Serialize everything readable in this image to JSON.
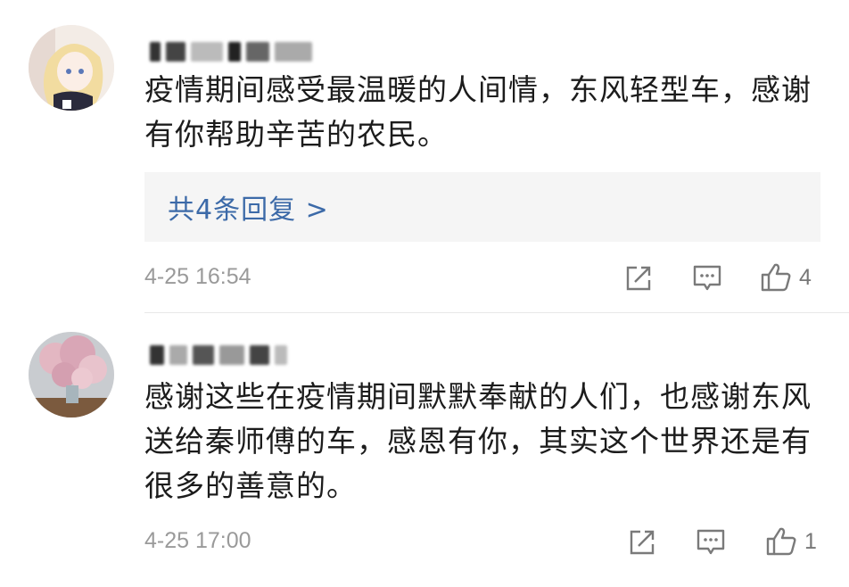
{
  "comments": [
    {
      "text": "疫情期间感受最温暖的人间情，东风轻型车，感谢有你帮助辛苦的农民。",
      "reply_label": "共4条回复 >",
      "time": "4-25 16:54",
      "likes": "4",
      "avatar_icon": "anime-girl-avatar"
    },
    {
      "text": "感谢这些在疫情期间默默奉献的人们，也感谢东风送给秦师傅的车，感恩有你，其实这个世界还是有很多的善意的。",
      "time": "4-25 17:00",
      "likes": "1",
      "avatar_icon": "flower-vase-avatar"
    }
  ],
  "colors": {
    "reply_link": "#3c6aa8",
    "meta_gray": "#9a9a9a",
    "reply_bg": "#f5f5f5"
  }
}
